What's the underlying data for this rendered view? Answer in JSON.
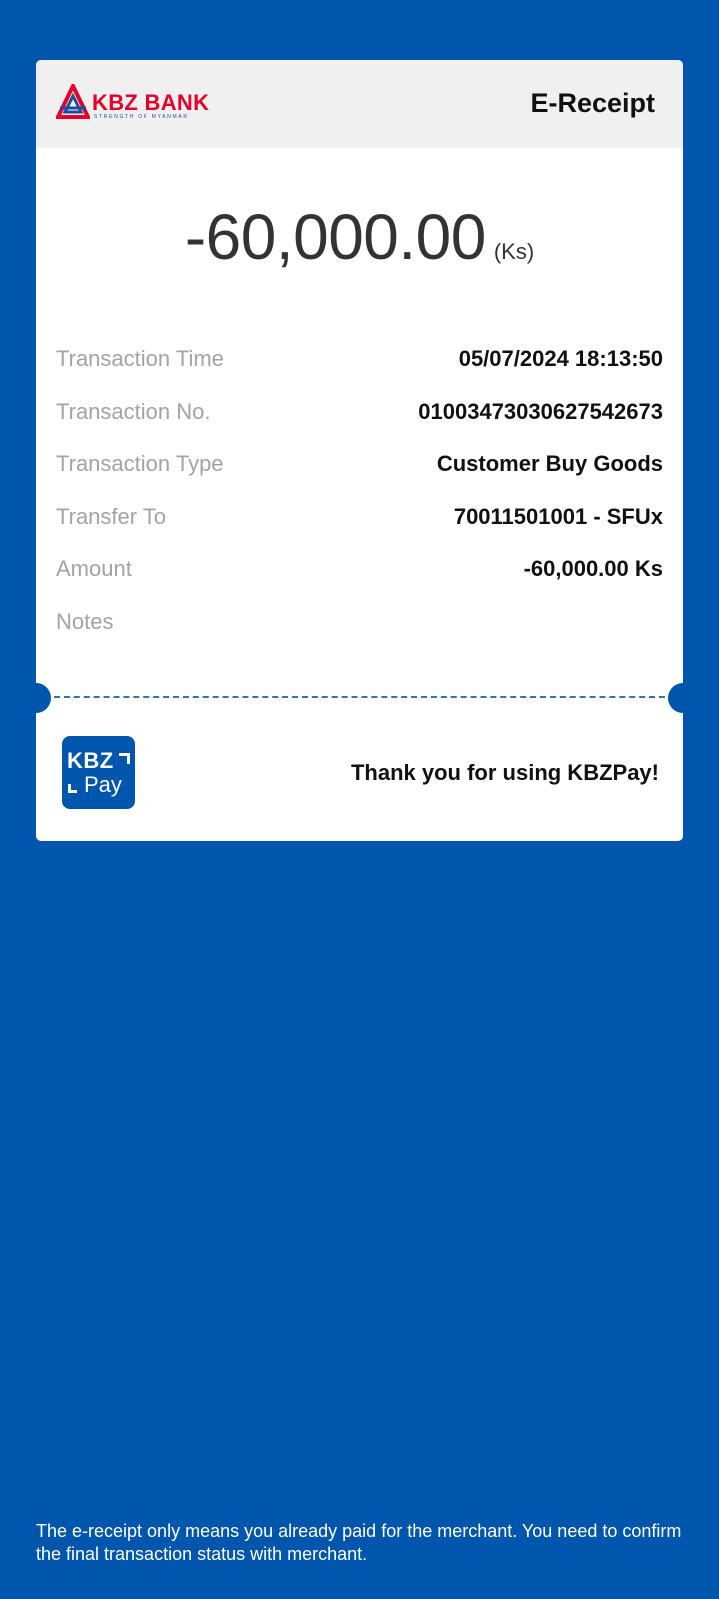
{
  "header": {
    "bank_name": "KBZ BANK",
    "bank_tagline": "STRENGTH OF MYANMAR",
    "title": "E-Receipt"
  },
  "amount": {
    "value": "-60,000.00",
    "unit": "(Ks)"
  },
  "details": [
    {
      "label": "Transaction Time",
      "value": "05/07/2024 18:13:50"
    },
    {
      "label": "Transaction No.",
      "value": "01003473030627542673"
    },
    {
      "label": "Transaction Type",
      "value": "Customer Buy Goods"
    },
    {
      "label": "Transfer To",
      "value": "70011501001 - SFUx"
    },
    {
      "label": "Amount",
      "value": "-60,000.00 Ks"
    },
    {
      "label": "Notes",
      "value": ""
    }
  ],
  "footer_card": {
    "logo_kbz": "KBZ",
    "logo_pay": "Pay",
    "thank_you": "Thank you for using KBZPay!"
  },
  "disclaimer": "The e-receipt only means you already paid for the merchant. You need to confirm the final transaction status with merchant.",
  "colors": {
    "background": "#0055ad",
    "brand_red": "#e4002b",
    "label_gray": "#a3a3a3"
  }
}
